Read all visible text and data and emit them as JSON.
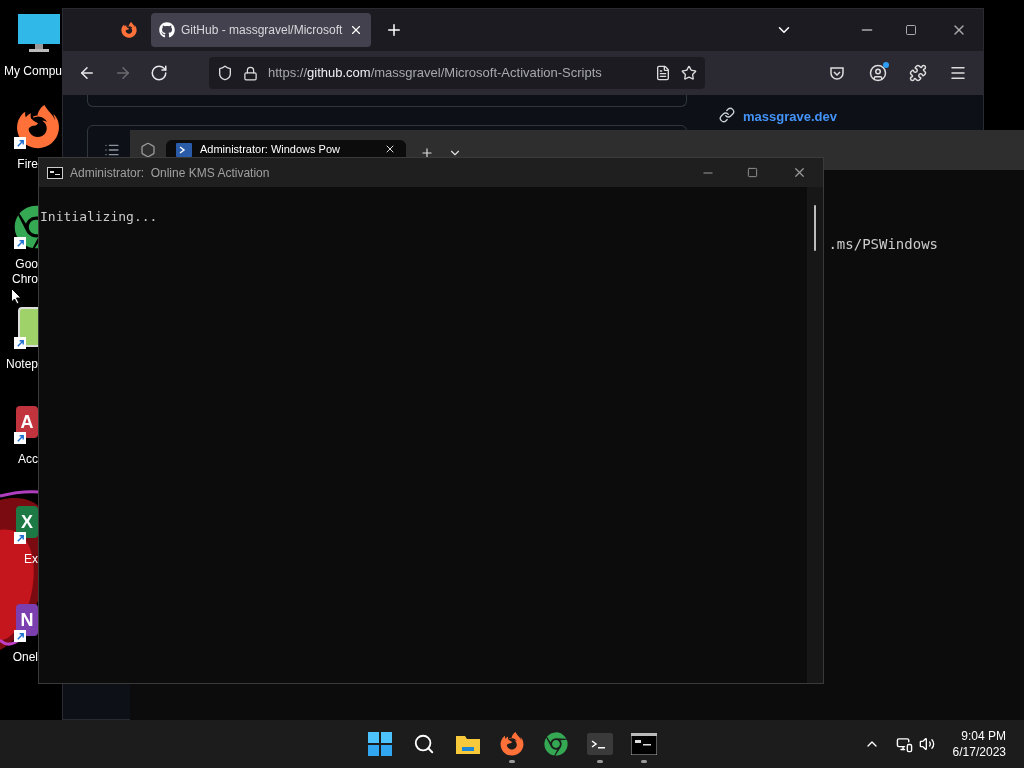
{
  "desktop": {
    "icons": [
      {
        "kind": "computer",
        "label": [
          "My Compu"
        ]
      },
      {
        "kind": "firefox",
        "label": [
          "Fire"
        ]
      },
      {
        "kind": "chrome",
        "label": [
          "Goo",
          "Chro"
        ]
      },
      {
        "kind": "notepad",
        "label": [
          "Notep"
        ]
      },
      {
        "kind": "access",
        "glyph": "A",
        "label": [
          "Acc"
        ]
      },
      {
        "kind": "excel",
        "glyph": "X",
        "label": [
          "Ex"
        ]
      },
      {
        "kind": "onenote",
        "glyph": "N",
        "label": [
          "Onel"
        ]
      }
    ]
  },
  "browser": {
    "tabs": [
      {
        "kind": "pinned",
        "selected": false
      },
      {
        "kind": "page",
        "title": "GitHub - massgravel/Microsoft",
        "selected": true
      }
    ],
    "nav": [
      {
        "kind": "back",
        "disabled": false
      },
      {
        "kind": "forward",
        "disabled": true
      },
      {
        "kind": "reload",
        "disabled": false
      }
    ],
    "url": {
      "scheme": "https://",
      "host": "github.com",
      "path": "/massgravel/Microsoft-Activation-Scripts"
    },
    "account_notification": true,
    "link": "massgrave.dev"
  },
  "terminal": {
    "tab_title": "Administrator: Windows Pow",
    "output": ".ms/PSWindows"
  },
  "console": {
    "title": "Administrator:  Online KMS Activation",
    "output": "Initializing..."
  },
  "taskbar": {
    "apps": [
      {
        "kind": "start",
        "running": false
      },
      {
        "kind": "search",
        "running": false
      },
      {
        "kind": "explorer",
        "running": false
      },
      {
        "kind": "firefox",
        "running": true
      },
      {
        "kind": "chrome",
        "running": false
      },
      {
        "kind": "terminal",
        "running": true
      },
      {
        "kind": "console",
        "running": true
      }
    ],
    "time": "9:04 PM",
    "date": "6/17/2023"
  }
}
